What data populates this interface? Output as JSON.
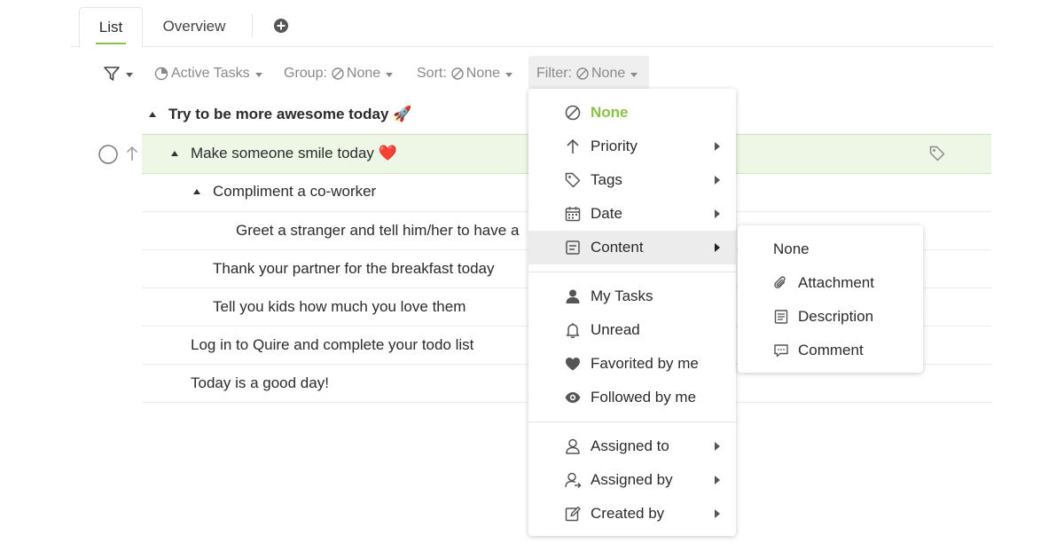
{
  "tabs": [
    {
      "label": "List",
      "active": true
    },
    {
      "label": "Overview",
      "active": false
    }
  ],
  "toolbar": {
    "active_tasks": "Active Tasks",
    "group_prefix": "Group:",
    "group_value": "None",
    "sort_prefix": "Sort:",
    "sort_value": "None",
    "filter_prefix": "Filter:",
    "filter_value": "None"
  },
  "tasks": [
    {
      "title": "Try to be more awesome today",
      "emoji": "🚀"
    },
    {
      "title": "Make someone smile today",
      "emoji": "❤️"
    },
    {
      "title": "Compliment a co-worker"
    },
    {
      "title": "Greet a stranger and tell him/her to have a"
    },
    {
      "title": "Thank your partner for the breakfast today"
    },
    {
      "title": "Tell you kids how much you love them"
    },
    {
      "title": "Log in to Quire and complete your todo list"
    },
    {
      "title": "Today is a good day!"
    }
  ],
  "filter_menu": {
    "items": [
      {
        "label": "None",
        "icon": "none-icon"
      },
      {
        "label": "Priority",
        "icon": "arrow-up-icon"
      },
      {
        "label": "Tags",
        "icon": "tag-icon"
      },
      {
        "label": "Date",
        "icon": "calendar-icon"
      },
      {
        "label": "Content",
        "icon": "content-icon"
      },
      {
        "label": "My Tasks",
        "icon": "person-icon"
      },
      {
        "label": "Unread",
        "icon": "bell-icon"
      },
      {
        "label": "Favorited by me",
        "icon": "heart-icon"
      },
      {
        "label": "Followed by me",
        "icon": "eye-icon"
      },
      {
        "label": "Assigned to",
        "icon": "user-outline-icon"
      },
      {
        "label": "Assigned by",
        "icon": "user-arrow-icon"
      },
      {
        "label": "Created by",
        "icon": "edit-icon"
      }
    ]
  },
  "content_submenu": {
    "items": [
      {
        "label": "None"
      },
      {
        "label": "Attachment",
        "icon": "paperclip-icon"
      },
      {
        "label": "Description",
        "icon": "document-icon"
      },
      {
        "label": "Comment",
        "icon": "comment-icon"
      }
    ]
  },
  "colors": {
    "accent": "#8bc34a",
    "highlight_row": "#eef6e6",
    "emoji_heart": "#e53935"
  }
}
